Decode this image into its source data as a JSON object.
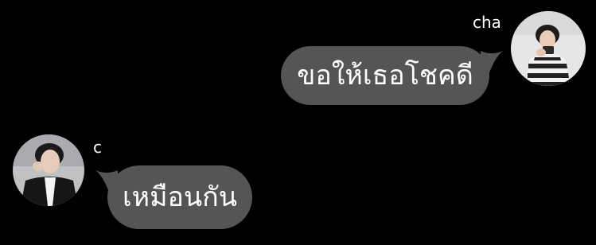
{
  "colors": {
    "background": "#000000",
    "bubble": "#555555",
    "text": "#ffffff"
  },
  "messages": [
    {
      "sender": "cha",
      "text": "ขอให้เธอโชคดี",
      "side": "right"
    },
    {
      "sender": "c",
      "text": "เหมือนกัน",
      "side": "left"
    }
  ]
}
